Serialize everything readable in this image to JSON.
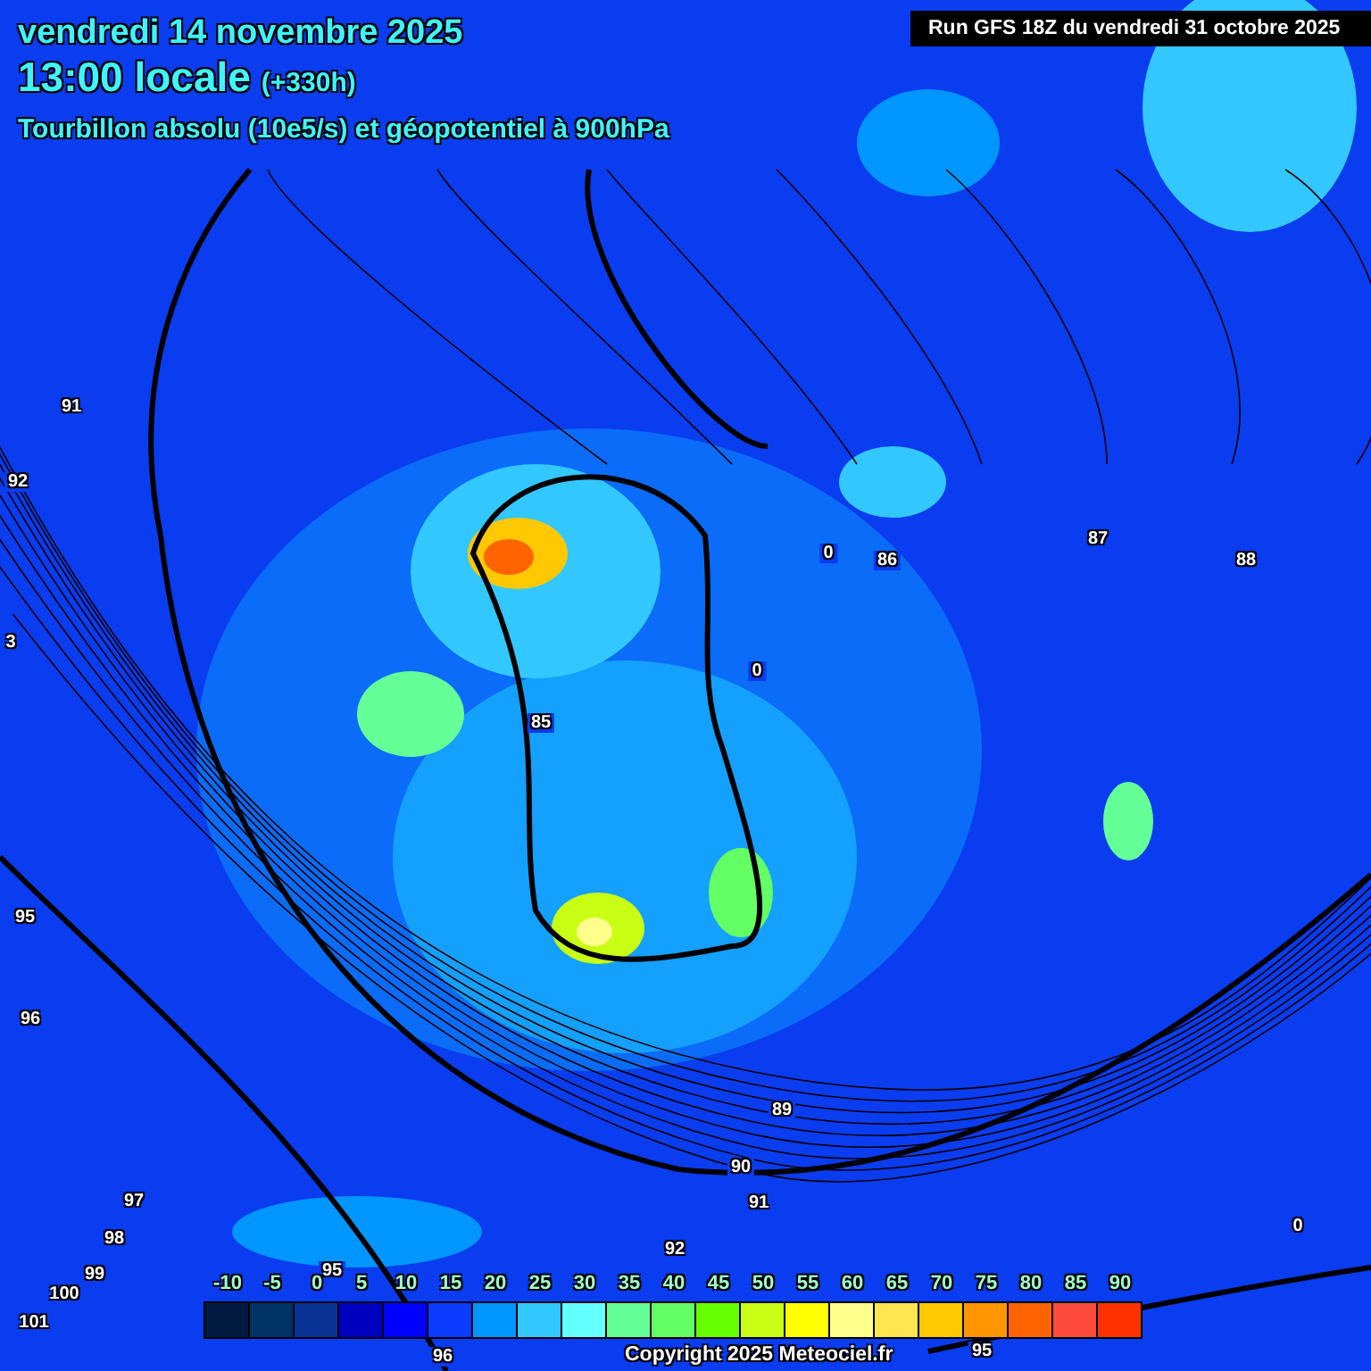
{
  "header": {
    "date": "vendredi 14 novembre 2025",
    "time": "13:00 locale",
    "offset": "(+330h)",
    "subtitle": "Tourbillon absolu (10e5/s) et géopotentiel à 900hPa"
  },
  "run_label": "Run GFS 18Z du vendredi 31 octobre 2025",
  "contour_labels": [
    "91",
    "92",
    "3",
    "85",
    "86",
    "87",
    "88",
    "95",
    "96",
    "97",
    "98",
    "99",
    "100",
    "101",
    "95",
    "96",
    "92",
    "91",
    "90",
    "89",
    "95",
    "0",
    "0",
    "0"
  ],
  "legend": [
    {
      "label": "-10",
      "color": "#001a40"
    },
    {
      "label": "-5",
      "color": "#003366"
    },
    {
      "label": "0",
      "color": "#0a3396"
    },
    {
      "label": "5",
      "color": "#0000c0"
    },
    {
      "label": "10",
      "color": "#0000ff"
    },
    {
      "label": "15",
      "color": "#0a3cff"
    },
    {
      "label": "20",
      "color": "#0096ff"
    },
    {
      "label": "25",
      "color": "#32c8ff"
    },
    {
      "label": "30",
      "color": "#64ffff"
    },
    {
      "label": "35",
      "color": "#64ff96"
    },
    {
      "label": "40",
      "color": "#64ff64"
    },
    {
      "label": "45",
      "color": "#64ff00"
    },
    {
      "label": "50",
      "color": "#c8ff14"
    },
    {
      "label": "55",
      "color": "#ffff00"
    },
    {
      "label": "60",
      "color": "#ffff8c"
    },
    {
      "label": "65",
      "color": "#ffe650"
    },
    {
      "label": "70",
      "color": "#ffc800"
    },
    {
      "label": "75",
      "color": "#ff9600"
    },
    {
      "label": "80",
      "color": "#ff6400"
    },
    {
      "label": "85",
      "color": "#ff4b3c"
    },
    {
      "label": "90",
      "color": "#ff3200"
    }
  ],
  "copyright": "Copyright 2025 Meteociel.fr"
}
